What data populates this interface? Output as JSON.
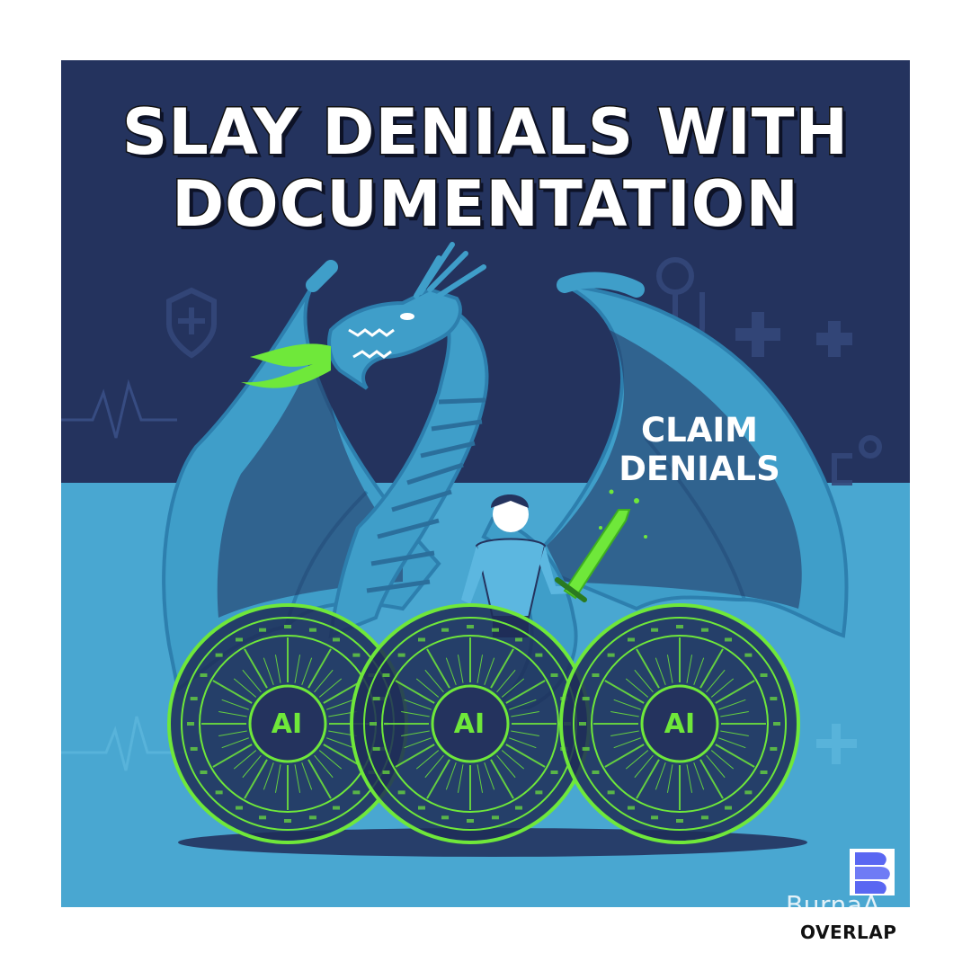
{
  "poster": {
    "title_line1": "SLAY DENIALS WITH",
    "title_line2": "DOCUMENTATION",
    "dragon_label_line1": "CLAIM",
    "dragon_label_line2": "DENIALS",
    "shields": [
      {
        "label": "AI"
      },
      {
        "label": "AI"
      },
      {
        "label": "AI"
      }
    ]
  },
  "watermark": {
    "brand_text": "BurnaA",
    "caption": "OVERLAP"
  },
  "colors": {
    "top_background": "#24335e",
    "bottom_background": "#49a7d1",
    "dragon": "#3f9ec9",
    "dragon_dark": "#1f2d57",
    "accent_green": "#6fe83a",
    "logo": "#5a67f2"
  }
}
